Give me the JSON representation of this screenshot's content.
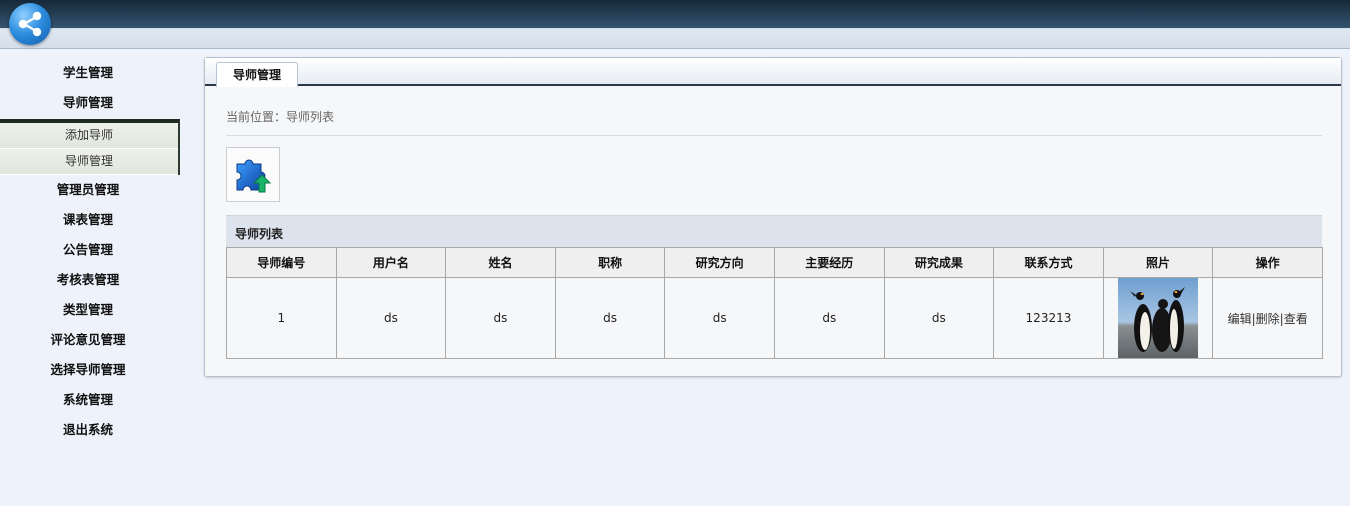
{
  "sidebar": {
    "items_top": [
      {
        "label": "学生管理"
      },
      {
        "label": "导师管理"
      }
    ],
    "submenu": [
      {
        "label": "添加导师"
      },
      {
        "label": "导师管理"
      }
    ],
    "items_bottom": [
      {
        "label": "管理员管理"
      },
      {
        "label": "课表管理"
      },
      {
        "label": "公告管理"
      },
      {
        "label": "考核表管理"
      },
      {
        "label": "类型管理"
      },
      {
        "label": "评论意见管理"
      },
      {
        "label": "选择导师管理"
      },
      {
        "label": "系统管理"
      },
      {
        "label": "退出系统"
      }
    ]
  },
  "panel": {
    "tab_label": "导师管理",
    "breadcrumb": "当前位置：导师列表",
    "list_title": "导师列表"
  },
  "table": {
    "columns": [
      "导师编号",
      "用户名",
      "姓名",
      "职称",
      "研究方向",
      "主要经历",
      "研究成果",
      "联系方式",
      "照片",
      "操作"
    ],
    "rows": [
      {
        "id": "1",
        "username": "ds",
        "name": "ds",
        "title": "ds",
        "research_direction": "ds",
        "experience": "ds",
        "achievements": "ds",
        "contact": "123213",
        "photo_icon": "penguins-photo",
        "actions": {
          "edit": "编辑",
          "delete": "删除",
          "view": "查看",
          "separator": "|"
        }
      }
    ]
  },
  "icons": {
    "logo": "share-nodes-logo-icon",
    "toolbar_button": "puzzle-upload-icon"
  },
  "colors": {
    "page_bg": "#eef2fa",
    "header_dark": "#1c3346",
    "list_header_bg": "#dde3ec",
    "table_header_bg": "#efefef"
  }
}
